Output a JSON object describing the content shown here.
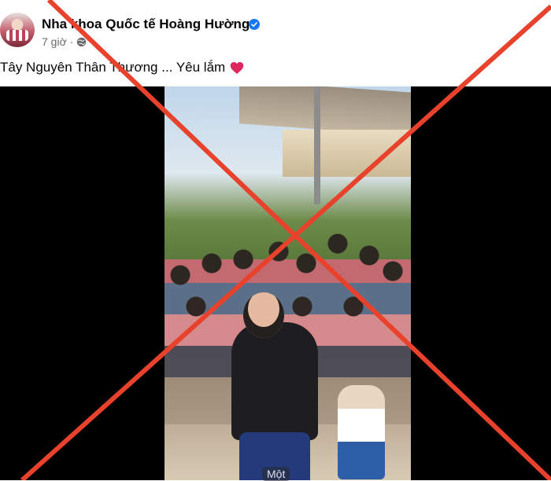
{
  "post": {
    "page_name": "Nha khoa Quốc tế Hoàng Hường",
    "time_ago": "7 giờ",
    "separator": "·",
    "caption": "Tây Nguyên Thân Thương ... Yêu lắm",
    "icons": {
      "verified": "verified-badge-icon",
      "audience": "globe-icon",
      "reaction": "red-heart-icon"
    }
  },
  "video": {
    "more_label": "Một"
  },
  "colors": {
    "verified": "#1877f2",
    "overlay_x": "#e8412c",
    "heart": "#e0245e"
  }
}
